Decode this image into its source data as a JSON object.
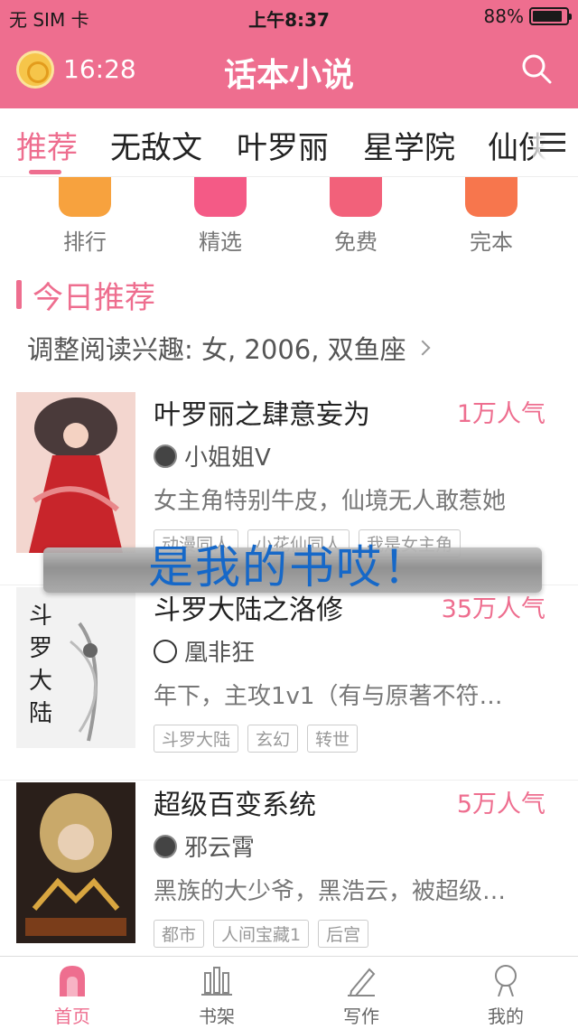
{
  "status_bar": {
    "carrier": "无 SIM 卡",
    "time": "上午8:37",
    "battery": "88%",
    "battery_level": 0.88
  },
  "header": {
    "timer": "16:28",
    "title": "话本小说"
  },
  "tabs": [
    "推荐",
    "无敌文",
    "叶罗丽",
    "星学院",
    "仙侠"
  ],
  "active_tab": 0,
  "categories": [
    {
      "label": "排行",
      "color": "#f7a23e"
    },
    {
      "label": "精选",
      "color": "#f45a86"
    },
    {
      "label": "免费",
      "color": "#f2617a"
    },
    {
      "label": "完本",
      "color": "#f7764d"
    }
  ],
  "section": {
    "title": "今日推荐",
    "interest": "调整阅读兴趣: 女, 2006, 双鱼座"
  },
  "books": [
    {
      "title": "叶罗丽之肆意妄为",
      "popularity": "1万人气",
      "author": "小姐姐V",
      "desc": "女主角特别牛皮，仙境无人敢惹她",
      "tags": [
        "动漫同人",
        "小花仙同人",
        "我是女主角"
      ]
    },
    {
      "title": "斗罗大陆之洛修",
      "popularity": "35万人气",
      "author": "凰非狂",
      "desc": "年下，主攻1v1（有与原著不符…",
      "tags": [
        "斗罗大陆",
        "玄幻",
        "转世"
      ]
    },
    {
      "title": "超级百变系统",
      "popularity": "5万人气",
      "author": "邪云霄",
      "desc": "黑族的大少爷，黑浩云，被超级…",
      "tags": [
        "都市",
        "人间宝藏1",
        "后宫"
      ]
    }
  ],
  "toast": "是我的书哎！",
  "bottom_nav": [
    {
      "label": "首页",
      "icon": "home-icon"
    },
    {
      "label": "书架",
      "icon": "bookshelf-icon"
    },
    {
      "label": "写作",
      "icon": "pen-icon"
    },
    {
      "label": "我的",
      "icon": "profile-icon"
    }
  ],
  "colors": {
    "accent": "#ee6e8f",
    "toast_text": "#1668c8"
  }
}
